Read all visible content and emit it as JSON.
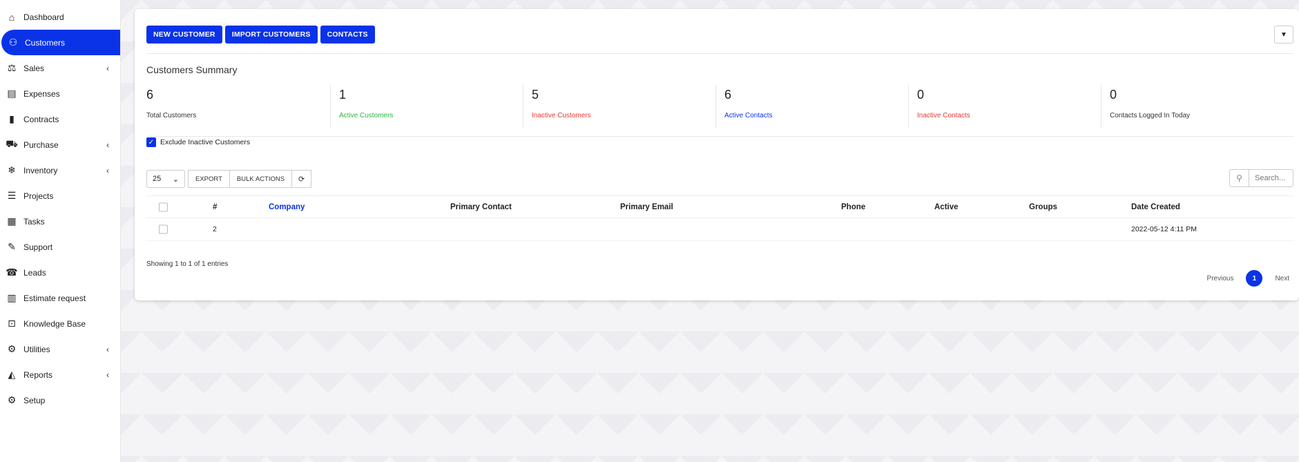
{
  "sidebar": {
    "items": [
      {
        "label": "Dashboard",
        "icon": "home-icon",
        "glyph": "⌂",
        "chevron": false,
        "active": false
      },
      {
        "label": "Customers",
        "icon": "user-icon",
        "glyph": "⚇",
        "chevron": false,
        "active": true
      },
      {
        "label": "Sales",
        "icon": "scale-icon",
        "glyph": "⚖",
        "chevron": true,
        "active": false
      },
      {
        "label": "Expenses",
        "icon": "file-text-icon",
        "glyph": "▤",
        "chevron": false,
        "active": false
      },
      {
        "label": "Contracts",
        "icon": "file-icon",
        "glyph": "▮",
        "chevron": false,
        "active": false
      },
      {
        "label": "Purchase",
        "icon": "cart-icon",
        "glyph": "⛟",
        "chevron": true,
        "active": false
      },
      {
        "label": "Inventory",
        "icon": "snowflake-icon",
        "glyph": "❄",
        "chevron": true,
        "active": false
      },
      {
        "label": "Projects",
        "icon": "bars-icon",
        "glyph": "☰",
        "chevron": false,
        "active": false
      },
      {
        "label": "Tasks",
        "icon": "tasks-icon",
        "glyph": "▦",
        "chevron": false,
        "active": false
      },
      {
        "label": "Support",
        "icon": "ticket-icon",
        "glyph": "✎",
        "chevron": false,
        "active": false
      },
      {
        "label": "Leads",
        "icon": "tty-icon",
        "glyph": "☎",
        "chevron": false,
        "active": false
      },
      {
        "label": "Estimate request",
        "icon": "list-alt-icon",
        "glyph": "▥",
        "chevron": false,
        "active": false
      },
      {
        "label": "Knowledge Base",
        "icon": "folder-open-icon",
        "glyph": "⊡",
        "chevron": false,
        "active": false
      },
      {
        "label": "Utilities",
        "icon": "cogs-icon",
        "glyph": "⚙",
        "chevron": true,
        "active": false
      },
      {
        "label": "Reports",
        "icon": "area-chart-icon",
        "glyph": "◭",
        "chevron": true,
        "active": false
      },
      {
        "label": "Setup",
        "icon": "cog-icon",
        "glyph": "⚙",
        "chevron": false,
        "active": false
      }
    ]
  },
  "actions": {
    "new_customer": "NEW CUSTOMER",
    "import_customers": "IMPORT CUSTOMERS",
    "contacts": "CONTACTS"
  },
  "summary": {
    "title": "Customers Summary",
    "stats": [
      {
        "value": "6",
        "label": "Total Customers",
        "color": "#333333"
      },
      {
        "value": "1",
        "label": "Active Customers",
        "color": "#2db843"
      },
      {
        "value": "5",
        "label": "Inactive Customers",
        "color": "#e53935"
      },
      {
        "value": "6",
        "label": "Active Contacts",
        "color": "#0a33e8"
      },
      {
        "value": "0",
        "label": "Inactive Contacts",
        "color": "#e53935"
      },
      {
        "value": "0",
        "label": "Contacts Logged In Today",
        "color": "#333333"
      }
    ]
  },
  "filters": {
    "exclude_inactive": "Exclude Inactive Customers"
  },
  "toolbar": {
    "page_length": "25",
    "export": "EXPORT",
    "bulk_actions": "BULK ACTIONS"
  },
  "search": {
    "placeholder": "Search..."
  },
  "table": {
    "headers": {
      "number": "#",
      "company": "Company",
      "primary_contact": "Primary Contact",
      "primary_email": "Primary Email",
      "phone": "Phone",
      "active": "Active",
      "groups": "Groups",
      "date_created": "Date Created"
    },
    "rows": [
      {
        "number": "2",
        "company": "",
        "primary_contact": "",
        "primary_email": "",
        "phone": "",
        "active": true,
        "groups": "",
        "date_created": "2022-05-12 4:11 PM"
      }
    ]
  },
  "footer": {
    "showing": "Showing 1 to 1 of 1 entries",
    "previous": "Previous",
    "page": "1",
    "next": "Next"
  },
  "colors": {
    "accent": "#0a33e8",
    "success": "#2db843",
    "danger": "#e53935"
  }
}
